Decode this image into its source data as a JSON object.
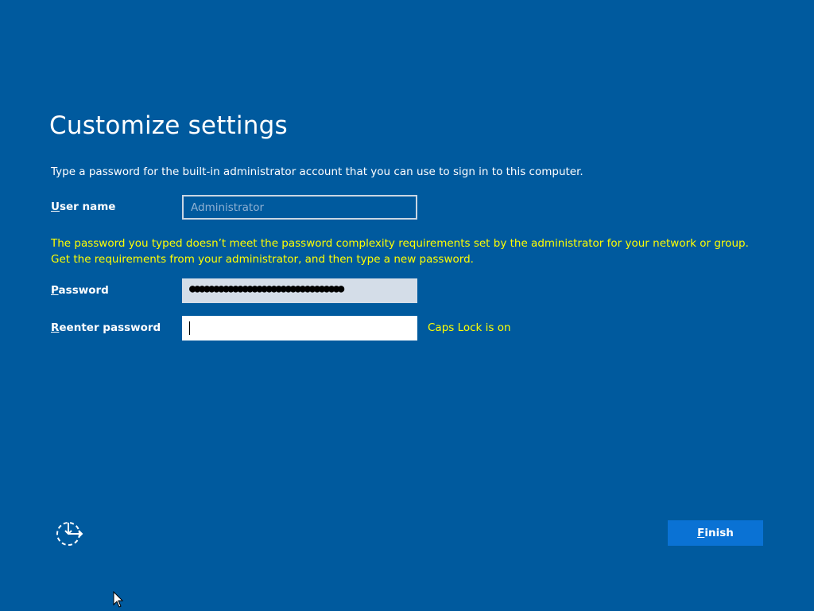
{
  "page": {
    "title": "Customize settings",
    "intro": "Type a password for the built-in administrator account that you can use to sign in to this computer."
  },
  "username": {
    "label_key": "U",
    "label_rest": "ser name",
    "value": "Administrator"
  },
  "warning": "The password you typed doesn’t meet the password complexity requirements set by the administrator for your network or group. Get the requirements from your administrator, and then type a new password.",
  "password": {
    "label_key": "P",
    "label_rest": "assword",
    "masked_value": "●●●●●●●●●●●●●●●●●●●●●●●●●●●●●●●●"
  },
  "reenter": {
    "label_key": "R",
    "label_rest": "eenter password",
    "value": ""
  },
  "caps_lock_note": "Caps Lock is on",
  "finish_button": {
    "key": "F",
    "rest": "inish"
  },
  "icons": {
    "ease_of_access": "ease-of-access-icon",
    "cursor": "mouse-pointer"
  },
  "colors": {
    "background": "#005a9e",
    "warning_text": "#ffff00",
    "button": "#0a72d4"
  }
}
